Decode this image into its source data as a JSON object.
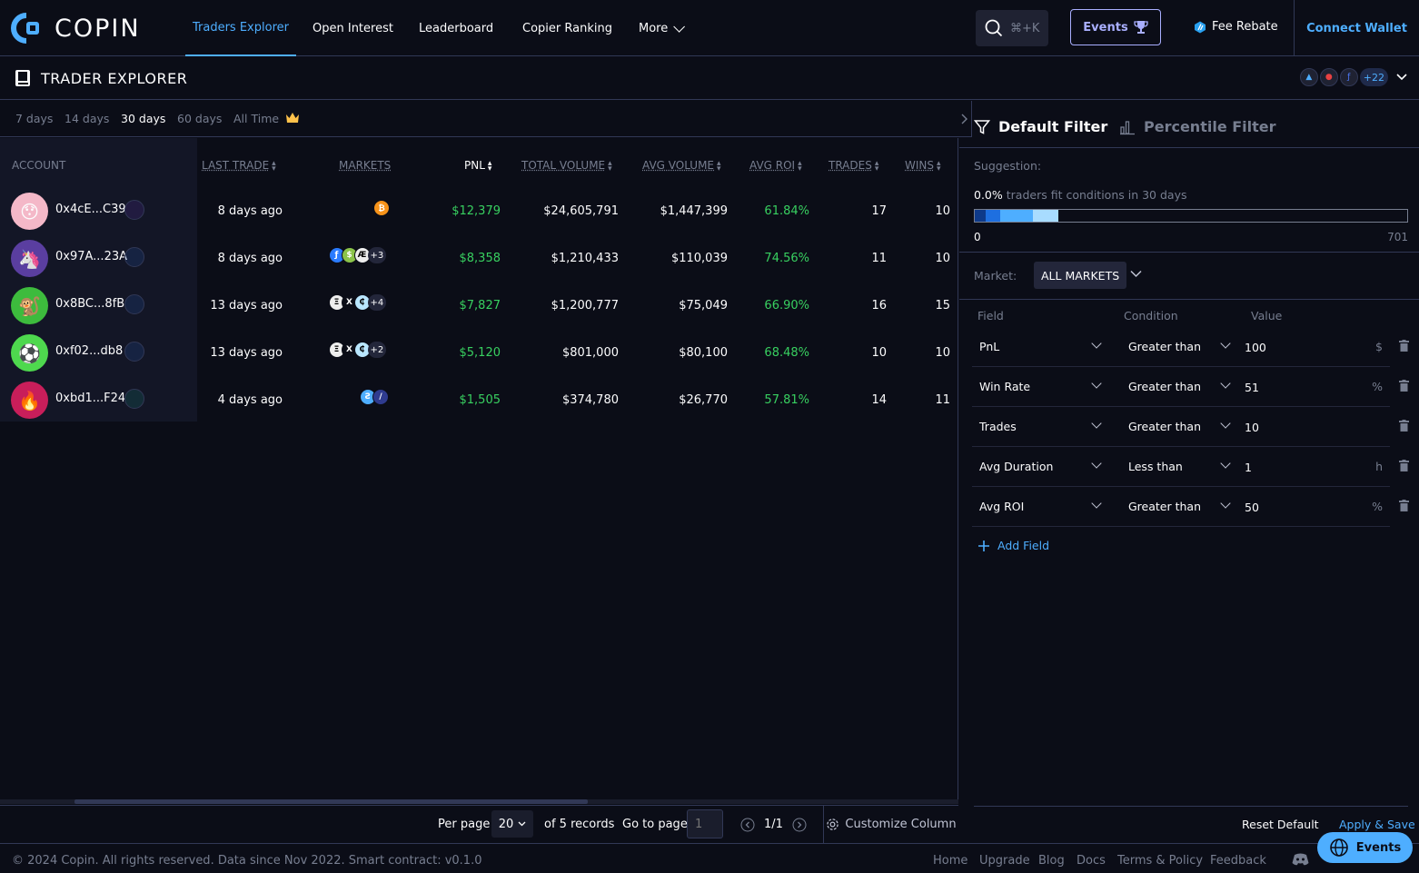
{
  "brand": {
    "name": "COPIN"
  },
  "nav": {
    "items": [
      {
        "label": "Traders Explorer"
      },
      {
        "label": "Open Interest"
      },
      {
        "label": "Leaderboard"
      },
      {
        "label": "Copier Ranking"
      },
      {
        "label": "More"
      }
    ],
    "search_shortcut": "⌘+K",
    "events_label": "Events",
    "fee_rebate_label": "Fee Rebate",
    "connect_wallet_label": "Connect Wallet"
  },
  "page": {
    "title": "TRADER EXPLORER",
    "protocols_more": "+22"
  },
  "timeframes": [
    {
      "label": "7 days"
    },
    {
      "label": "14 days"
    },
    {
      "label": "30 days",
      "active": true
    },
    {
      "label": "60 days"
    },
    {
      "label": "All Time"
    }
  ],
  "table": {
    "headers": {
      "account": "ACCOUNT",
      "last_trade": "LAST TRADE",
      "markets": "MARKETS",
      "pnl": "PNL",
      "total_volume": "TOTAL VOLUME",
      "avg_volume": "AVG VOLUME",
      "avg_roi": "AVG ROI",
      "trades": "TRADES",
      "wins": "WINS"
    },
    "rows": [
      {
        "account": "0x4cE...C39",
        "avatar": "😯",
        "avatar_bg": "#f4b8c8",
        "last_trade": "8 days ago",
        "markets_more": "",
        "pnl": "$12,379",
        "total_volume": "$24,605,791",
        "avg_volume": "$1,447,399",
        "avg_roi": "61.84%",
        "trades": "17",
        "wins": "10"
      },
      {
        "account": "0x97A...23A",
        "avatar": "🦄",
        "avatar_bg": "#5a3ea0",
        "last_trade": "8 days ago",
        "markets_more": "+3",
        "pnl": "$8,358",
        "total_volume": "$1,210,433",
        "avg_volume": "$110,039",
        "avg_roi": "74.56%",
        "trades": "11",
        "wins": "10"
      },
      {
        "account": "0x8BC...8fB",
        "avatar": "🐒",
        "avatar_bg": "#3dbb3d",
        "last_trade": "13 days ago",
        "markets_more": "+4",
        "pnl": "$7,827",
        "total_volume": "$1,200,777",
        "avg_volume": "$75,049",
        "avg_roi": "66.90%",
        "trades": "16",
        "wins": "15"
      },
      {
        "account": "0xf02...db8",
        "avatar": "⚽",
        "avatar_bg": "#4ed84e",
        "last_trade": "13 days ago",
        "markets_more": "+2",
        "pnl": "$5,120",
        "total_volume": "$801,000",
        "avg_volume": "$80,100",
        "avg_roi": "68.48%",
        "trades": "10",
        "wins": "10"
      },
      {
        "account": "0xbd1...F24",
        "avatar": "🔥",
        "avatar_bg": "#c81e5a",
        "last_trade": "4 days ago",
        "markets_more": "",
        "pnl": "$1,505",
        "total_volume": "$374,780",
        "avg_volume": "$26,770",
        "avg_roi": "57.81%",
        "trades": "14",
        "wins": "11"
      }
    ]
  },
  "pager": {
    "per_page_label": "Per page",
    "per_page_value": "20",
    "records": "of 5 records",
    "goto_label": "Go to page",
    "goto_placeholder": "1",
    "page_indicator": "1/1",
    "customize_label": "Customize Column"
  },
  "filter": {
    "tab_default": "Default Filter",
    "tab_percentile": "Percentile Filter",
    "suggestion_label": "Suggestion:",
    "suggestion_percent": "0.0%",
    "suggestion_text": "traders fit conditions in 30 days",
    "bar_min": "0",
    "bar_max": "701",
    "market_label": "Market:",
    "market_value": "ALL MARKETS",
    "col_field": "Field",
    "col_condition": "Condition",
    "col_value": "Value",
    "rows": [
      {
        "field": "PnL",
        "condition": "Greater than",
        "value": "100",
        "unit": "$"
      },
      {
        "field": "Win Rate",
        "condition": "Greater than",
        "value": "51",
        "unit": "%"
      },
      {
        "field": "Trades",
        "condition": "Greater than",
        "value": "10",
        "unit": ""
      },
      {
        "field": "Avg Duration",
        "condition": "Less than",
        "value": "1",
        "unit": "h"
      },
      {
        "field": "Avg ROI",
        "condition": "Greater than",
        "value": "50",
        "unit": "%"
      }
    ],
    "add_field_label": "Add Field",
    "reset_label": "Reset Default",
    "apply_label": "Apply & Save"
  },
  "footer": {
    "copyright": "© 2024 Copin. All rights reserved. Data since Nov 2022. Smart contract: v0.1.0",
    "links": [
      {
        "label": "Home"
      },
      {
        "label": "Upgrade"
      },
      {
        "label": "Blog"
      },
      {
        "label": "Docs"
      },
      {
        "label": "Terms & Policy"
      },
      {
        "label": "Feedback"
      }
    ],
    "events_float_label": "Events"
  },
  "colors": {
    "accent": "#4eaeff",
    "positive": "#38d060",
    "bg": "#0b0d17",
    "border": "#313856"
  }
}
